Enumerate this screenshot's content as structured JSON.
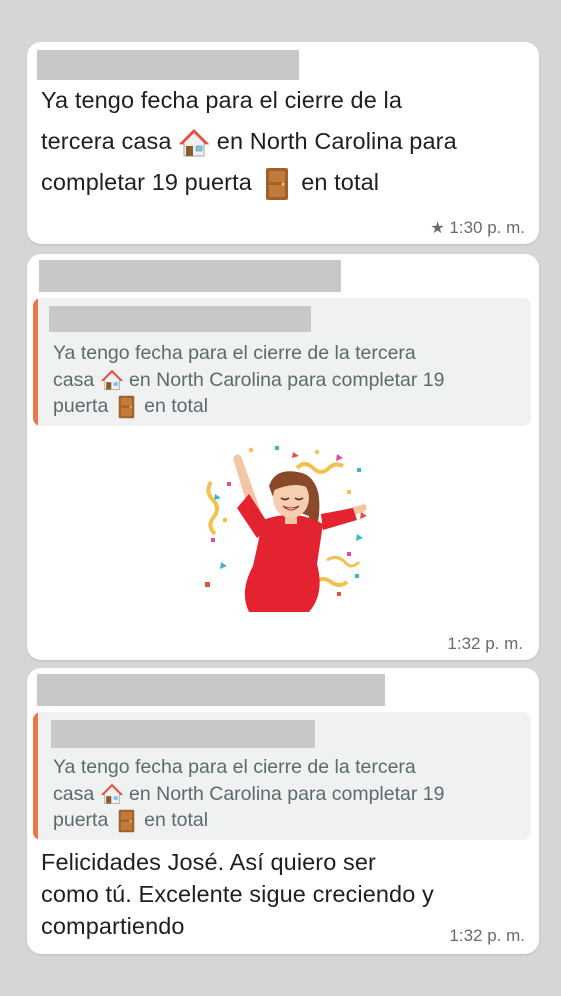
{
  "messages": [
    {
      "sender_redacted": true,
      "line1": "Ya tengo fecha para el cierre de la",
      "line2a": "tercera casa",
      "line2b": "en North Carolina para",
      "line3a": "completar 19 puerta",
      "line3b": "en total",
      "starred": true,
      "time": "1:30 p. m."
    },
    {
      "sender_redacted": true,
      "quote": {
        "line1": "Ya tengo fecha para el cierre de la tercera",
        "line2a": "casa",
        "line2b": "en North Carolina para completar 19",
        "line3a": "puerta",
        "line3b": "en total"
      },
      "sticker": "celebrating-woman-sticker",
      "time": "1:32 p. m."
    },
    {
      "sender_redacted": true,
      "quote": {
        "line1": "Ya tengo fecha para el cierre de la tercera",
        "line2a": "casa",
        "line2b": "en North Carolina para completar 19",
        "line3a": "puerta",
        "line3b": "en total"
      },
      "line1": "Felicidades José. Así quiero ser",
      "line2": "como tú. Excelente sigue creciendo y",
      "line3": "compartiendo",
      "time": "1:32 p. m."
    }
  ],
  "colors": {
    "background": "#d6d6d6",
    "bubble": "#ffffff",
    "quote_bar": "#e9774a",
    "quote_bg": "#f0f2f2",
    "redaction": "#c8c8c8"
  },
  "icons": [
    "house-emoji-icon",
    "door-emoji-icon",
    "star-icon"
  ]
}
